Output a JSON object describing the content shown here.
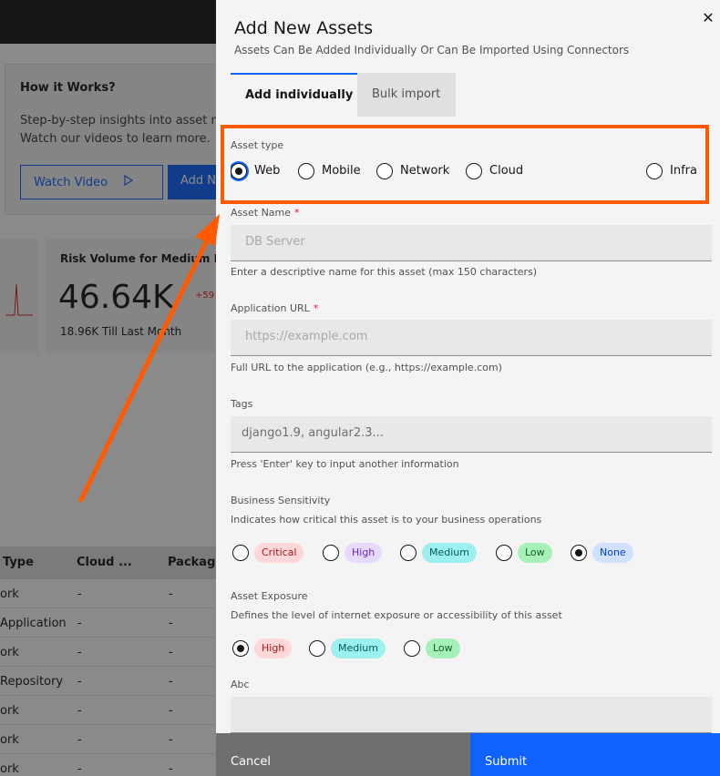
{
  "background": {
    "how_it_works": {
      "title": "How it Works?",
      "text_line1": "Step-by-step insights into asset m",
      "text_line2": "Watch our videos to learn more.",
      "watch_video_label": "Watch Video",
      "add_label": "Add N"
    },
    "risk_card": {
      "title": "Risk Volume for Medium E",
      "value": "46.64K",
      "badge": "+59",
      "sub": "18.96K Till Last Month"
    },
    "table": {
      "headers": [
        "Type",
        "Cloud ...",
        "Package"
      ],
      "rows": [
        [
          "ork",
          "-",
          "-"
        ],
        [
          "Application",
          "-",
          "-"
        ],
        [
          "ork",
          "-",
          "-"
        ],
        [
          "Repository",
          "-",
          "-"
        ],
        [
          "ork",
          "-",
          "-"
        ],
        [
          "ork",
          "-",
          "-"
        ],
        [
          "ork",
          "-",
          "-"
        ]
      ]
    }
  },
  "modal": {
    "title": "Add New Assets",
    "subtitle": "Assets Can Be Added Individually Or Can Be Imported Using Connectors",
    "close_icon": "close-icon",
    "tabs": [
      {
        "label": "Add individually",
        "active": true
      },
      {
        "label": "Bulk import",
        "active": false
      }
    ],
    "asset_type": {
      "label": "Asset type",
      "options": [
        "Web",
        "Mobile",
        "Network",
        "Cloud",
        "Infra"
      ],
      "selected": "Web"
    },
    "asset_name": {
      "label": "Asset Name",
      "required_mark": "*",
      "placeholder": "DB Server",
      "helper": "Enter a descriptive name for this asset (max 150 characters)"
    },
    "application_url": {
      "label": "Application URL",
      "required_mark": "*",
      "placeholder": "https://example.com",
      "helper": "Full URL to the application (e.g., https://example.com)"
    },
    "tags": {
      "label": "Tags",
      "placeholder": "django1.9, angular2.3...",
      "helper": "Press 'Enter' key to input another information"
    },
    "business_sensitivity": {
      "label": "Business Sensitivity",
      "description": "Indicates how critical this asset is to your business operations",
      "options": [
        {
          "label": "Critical",
          "bg": "#ffd7d9",
          "fg": "#a2191f"
        },
        {
          "label": "High",
          "bg": "#e8daff",
          "fg": "#6929c4"
        },
        {
          "label": "Medium",
          "bg": "#9ef0f0",
          "fg": "#005d5d"
        },
        {
          "label": "Low",
          "bg": "#a7f0ba",
          "fg": "#0e6027"
        },
        {
          "label": "None",
          "bg": "#d0e2ff",
          "fg": "#0043ce"
        }
      ],
      "selected": "None"
    },
    "asset_exposure": {
      "label": "Asset Exposure",
      "description": "Defines the level of internet exposure or accessibility of this asset",
      "options": [
        {
          "label": "High",
          "bg": "#ffd7d9",
          "fg": "#a2191f"
        },
        {
          "label": "Medium",
          "bg": "#9ef0f0",
          "fg": "#005d5d"
        },
        {
          "label": "Low",
          "bg": "#a7f0ba",
          "fg": "#0e6027"
        }
      ],
      "selected": "High"
    },
    "abc": {
      "label": "Abc"
    },
    "footer": {
      "cancel_label": "Cancel",
      "submit_label": "Submit"
    }
  },
  "annotation": {
    "color": "#ff5a00"
  }
}
